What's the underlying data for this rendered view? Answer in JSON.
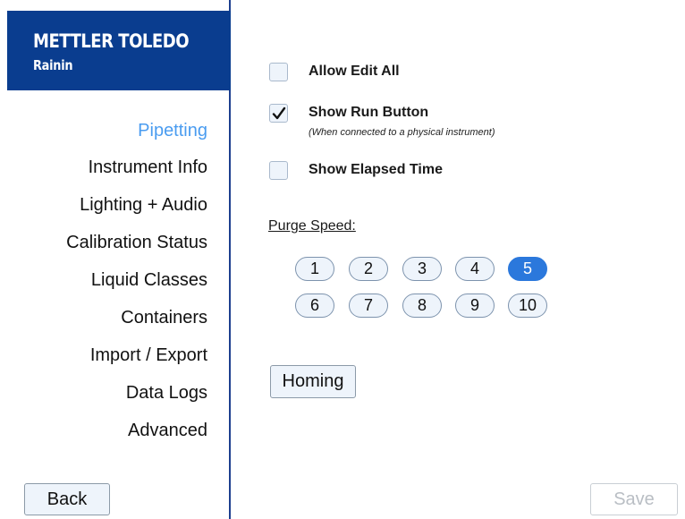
{
  "brand": {
    "name": "METTLER TOLEDO",
    "sub": "Rainin",
    "color": "#0a3d8f"
  },
  "sidebar": {
    "items": [
      {
        "label": "Pipetting",
        "active": true
      },
      {
        "label": "Instrument Info"
      },
      {
        "label": "Lighting + Audio"
      },
      {
        "label": "Calibration Status"
      },
      {
        "label": "Liquid Classes"
      },
      {
        "label": "Containers"
      },
      {
        "label": "Import / Export"
      },
      {
        "label": "Data Logs"
      },
      {
        "label": "Advanced"
      }
    ],
    "back_label": "Back"
  },
  "options": {
    "allow_edit_all": {
      "label": "Allow Edit All",
      "checked": false
    },
    "show_run_button": {
      "label": "Show Run Button",
      "note": "(When connected to a physical instrument)",
      "checked": true
    },
    "show_elapsed_time": {
      "label": "Show Elapsed Time",
      "checked": false
    }
  },
  "purge": {
    "label": "Purge Speed:",
    "speeds": [
      "1",
      "2",
      "3",
      "4",
      "5",
      "6",
      "7",
      "8",
      "9",
      "10"
    ],
    "selected": "5",
    "selected_color": "#2b78dc"
  },
  "actions": {
    "homing_label": "Homing",
    "save_label": "Save",
    "save_enabled": false
  },
  "colors": {
    "active_nav": "#4a9cf0",
    "divider": "#1d3f8f"
  }
}
